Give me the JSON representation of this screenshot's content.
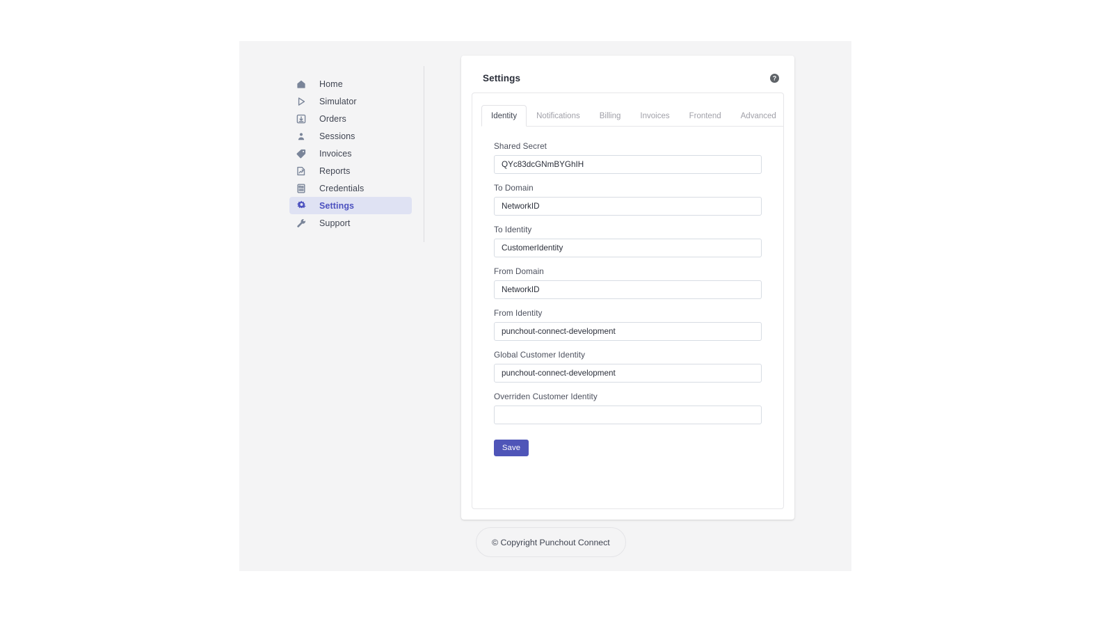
{
  "sidebar": {
    "items": [
      {
        "label": "Home",
        "icon": "home-icon",
        "active": false
      },
      {
        "label": "Simulator",
        "icon": "play-icon",
        "active": false
      },
      {
        "label": "Orders",
        "icon": "download-box-icon",
        "active": false
      },
      {
        "label": "Sessions",
        "icon": "user-icon",
        "active": false
      },
      {
        "label": "Invoices",
        "icon": "tag-icon",
        "active": false
      },
      {
        "label": "Reports",
        "icon": "report-chart-icon",
        "active": false
      },
      {
        "label": "Credentials",
        "icon": "id-card-icon",
        "active": false
      },
      {
        "label": "Settings",
        "icon": "gear-icon",
        "active": true
      },
      {
        "label": "Support",
        "icon": "wrench-icon",
        "active": false
      }
    ]
  },
  "card": {
    "title": "Settings",
    "help_icon": "help-circle-icon"
  },
  "tabs": [
    {
      "label": "Identity",
      "active": true
    },
    {
      "label": "Notifications",
      "active": false
    },
    {
      "label": "Billing",
      "active": false
    },
    {
      "label": "Invoices",
      "active": false
    },
    {
      "label": "Frontend",
      "active": false
    },
    {
      "label": "Advanced",
      "active": false
    }
  ],
  "form": {
    "fields": [
      {
        "name": "shared-secret",
        "label": "Shared Secret",
        "value": "QYc83dcGNmBYGhIH",
        "placeholder": ""
      },
      {
        "name": "to-domain",
        "label": "To Domain",
        "value": "NetworkID",
        "placeholder": ""
      },
      {
        "name": "to-identity",
        "label": "To Identity",
        "value": "CustomerIdentity",
        "placeholder": ""
      },
      {
        "name": "from-domain",
        "label": "From Domain",
        "value": "NetworkID",
        "placeholder": ""
      },
      {
        "name": "from-identity",
        "label": "From Identity",
        "value": "punchout-connect-development",
        "placeholder": ""
      },
      {
        "name": "global-customer-identity",
        "label": "Global Customer Identity",
        "value": "punchout-connect-development",
        "placeholder": ""
      },
      {
        "name": "overriden-customer-identity",
        "label": "Overriden Customer Identity",
        "value": "",
        "placeholder": ""
      }
    ],
    "save_label": "Save"
  },
  "footer": {
    "copyright": "© Copyright Punchout Connect"
  },
  "colors": {
    "accent": "#4f55b8",
    "active_nav_bg": "#dfe2f3",
    "page_bg": "#f4f4f5",
    "border": "#e6e6e9"
  }
}
